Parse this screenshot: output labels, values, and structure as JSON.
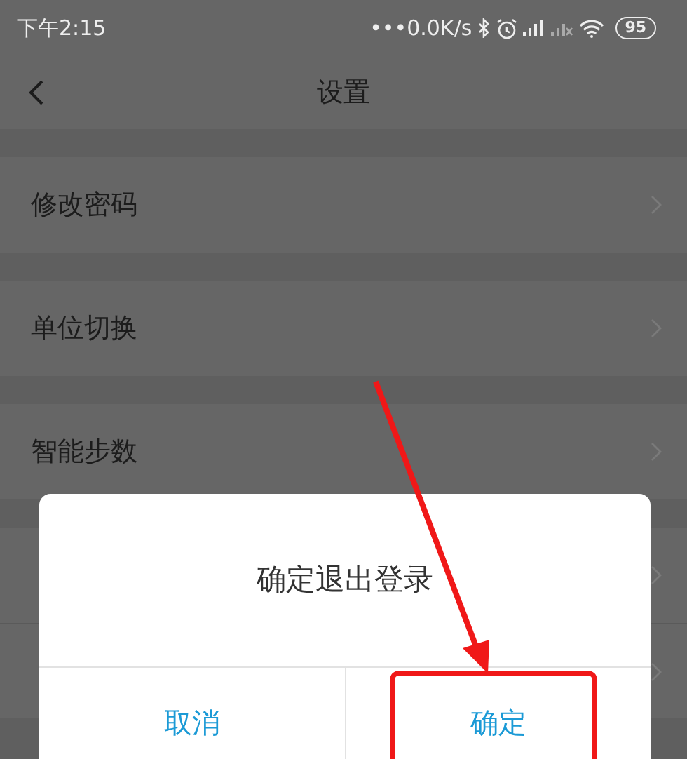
{
  "status_bar": {
    "time": "下午2:15",
    "network_speed": "•••0.0K/s",
    "battery": "95"
  },
  "header": {
    "title": "设置"
  },
  "dimmed": true,
  "sections": [
    {
      "items": [
        {
          "kind": "label",
          "label": "修改密码"
        }
      ]
    },
    {
      "items": [
        {
          "kind": "label",
          "label": "单位切换"
        }
      ]
    },
    {
      "items": [
        {
          "kind": "label",
          "label": "智能步数"
        }
      ]
    },
    {
      "items": [
        {
          "kind": "covered"
        },
        {
          "kind": "covered"
        }
      ]
    }
  ],
  "dialog": {
    "message": "确定退出登录",
    "buttons": [
      {
        "label": "取消"
      },
      {
        "label": "确定"
      }
    ]
  }
}
